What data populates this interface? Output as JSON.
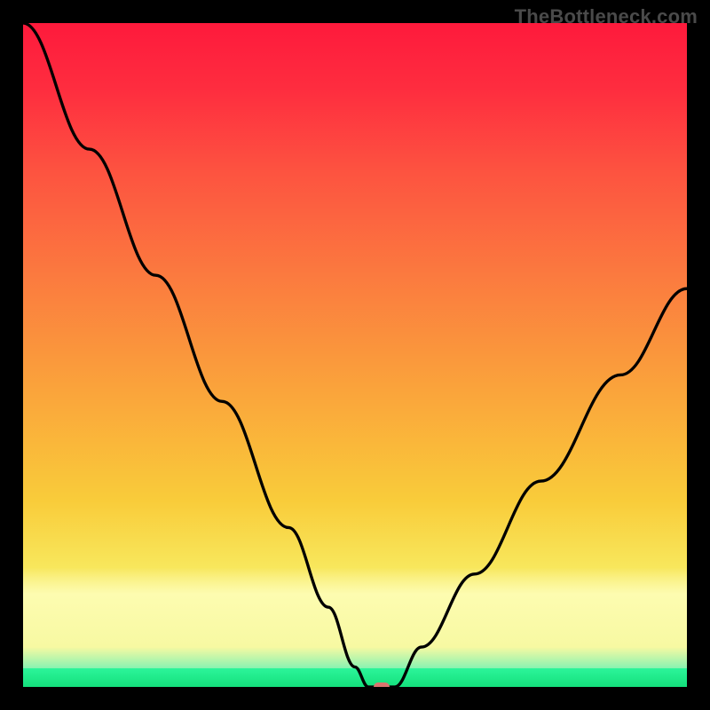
{
  "watermark": "TheBottleneck.com",
  "chart_data": {
    "type": "line",
    "title": "",
    "xlabel": "",
    "ylabel": "",
    "xlim": [
      0,
      100
    ],
    "ylim": [
      0,
      100
    ],
    "grid": false,
    "legend": false,
    "annotations": [],
    "series": [
      {
        "name": "bottleneck-curve",
        "x": [
          0,
          10,
          20,
          30,
          40,
          46,
          50,
          52,
          56,
          60,
          68,
          78,
          90,
          100
        ],
        "values": [
          100,
          81,
          62,
          43,
          24,
          12,
          3,
          0,
          0,
          6,
          17,
          31,
          47,
          60
        ]
      }
    ],
    "optimum_marker": {
      "x_percent": 54,
      "y_percent": 0
    },
    "background_gradient_stops": [
      {
        "pos": 0,
        "color": "#fe1a3c"
      },
      {
        "pos": 22,
        "color": "#fd5240"
      },
      {
        "pos": 55,
        "color": "#faa33b"
      },
      {
        "pos": 82,
        "color": "#f8e75c"
      },
      {
        "pos": 94,
        "color": "#f7f9a2"
      },
      {
        "pos": 100,
        "color": "#14e07c"
      }
    ]
  }
}
